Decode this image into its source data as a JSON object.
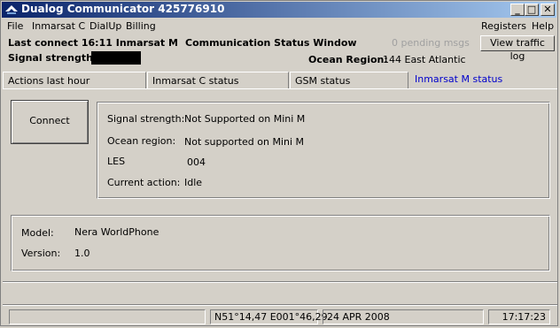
{
  "window": {
    "title": "Dualog Communicator 425776910"
  },
  "menu": {
    "left": [
      "File",
      "Inmarsat C",
      "DialUp",
      "Billing"
    ],
    "right": [
      "Registers",
      "Help"
    ]
  },
  "header": {
    "last_connect": "Last connect 16:11 Inmarsat M",
    "window_title": "Communication Status Window",
    "pending": "0  pending msgs",
    "view_traffic_log": "View traffic log",
    "signal_strength_label": "Signal strength:",
    "ocean_region_label": "Ocean Region:",
    "ocean_region_value": "144 East Atlantic"
  },
  "tabs": [
    "Actions last hour",
    "Inmarsat C status",
    "GSM status",
    "Inmarsat M status"
  ],
  "status_panel": {
    "connect_button": "Connect",
    "rows": [
      {
        "label": "Signal strength:",
        "value": "Not Supported on Mini M"
      },
      {
        "label": "Ocean region:",
        "value": "Not supported on Mini M"
      },
      {
        "label": "LES",
        "value": "004"
      },
      {
        "label": "Current action:",
        "value": "Idle"
      }
    ],
    "model_label": "Model:",
    "model_value": "Nera WorldPhone",
    "version_label": "Version:",
    "version_value": "1.0"
  },
  "statusbar": {
    "position": "N51°14,47  E001°46,29",
    "date": "24 APR 2008",
    "time": "17:17:23"
  }
}
